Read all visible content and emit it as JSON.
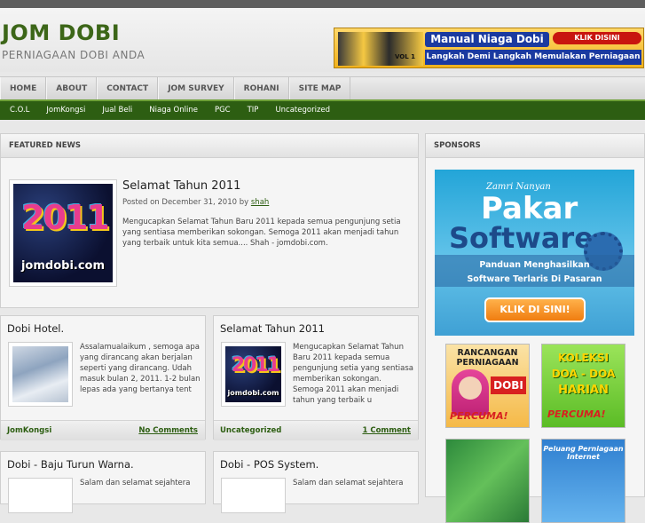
{
  "site": {
    "title": "JOM DOBI",
    "description": "PERNIAGAAN DOBI ANDA"
  },
  "banner": {
    "title": "Manual Niaga Dobi",
    "badge": "KLIK DISINI",
    "tagline": "Langkah Demi Langkah Memulakan Perniagaan Dobi",
    "vol": "VOL 1"
  },
  "nav": {
    "items": [
      "HOME",
      "ABOUT",
      "CONTACT",
      "JOM SURVEY",
      "ROHANI",
      "SITE MAP"
    ]
  },
  "subnav": {
    "items": [
      "C.O.L",
      "JomKongsi",
      "Jual Beli",
      "Niaga Online",
      "PGC",
      "TIP",
      "Uncategorized"
    ]
  },
  "featured": {
    "heading": "FEATURED NEWS",
    "title": "Selamat Tahun 2011",
    "meta_prefix": "Posted on December 31, 2010 by",
    "author": "shah",
    "excerpt": "Mengucapkan Selamat Tahun Baru 2011 kepada semua pengunjung setia yang sentiasa memberikan sokongan. Semoga 2011 akan menjadi tahun yang terbaik untuk kita semua.... Shah - jomdobi.com.",
    "image_digits": "2011",
    "image_brand": "jomdobi.com"
  },
  "posts": [
    {
      "title": "Dobi Hotel.",
      "excerpt": "Assalamualaikum , semoga apa yang dirancang akan berjalan seperti yang dirancang. Udah masuk bulan 2, 2011. 1-2 bulan lepas ada yang bertanya tent",
      "category": "JomKongsi",
      "comments": "No Comments"
    },
    {
      "title": "Selamat Tahun 2011",
      "excerpt": "Mengucapkan Selamat Tahun Baru 2011 kepada semua pengunjung setia yang sentiasa memberikan sokongan. Semoga 2011 akan menjadi tahun yang terbaik u",
      "category": "Uncategorized",
      "comments": "1 Comment",
      "image_digits": "2011",
      "image_brand": "jomdobi.com"
    },
    {
      "title": "Dobi - Baju Turun Warna.",
      "excerpt": "Salam dan selamat sejahtera"
    },
    {
      "title": "Dobi - POS System.",
      "excerpt": "Salam dan selamat sejahtera"
    }
  ],
  "sponsors": {
    "heading": "SPONSORS",
    "pakar": {
      "author": "Zamri Nanyan",
      "word1": "Pakar",
      "word2": "Software",
      "line1": "Panduan Menghasilkan",
      "line2": "Software Terlaris Di Pasaran",
      "button": "KLIK DI SINI!"
    },
    "ad_rancangan": {
      "line": "RANCANGAN PERNIAGAAN",
      "word": "DOBI",
      "percuma": "PERCUMA!"
    },
    "ad_koleksi": {
      "l1": "KOLEKSI",
      "l2": "DOA - DOA",
      "l3": "HARIAN",
      "percuma": "PERCUMA!"
    },
    "ad_peluang": {
      "line": "Peluang Perniagaan Internet"
    }
  }
}
